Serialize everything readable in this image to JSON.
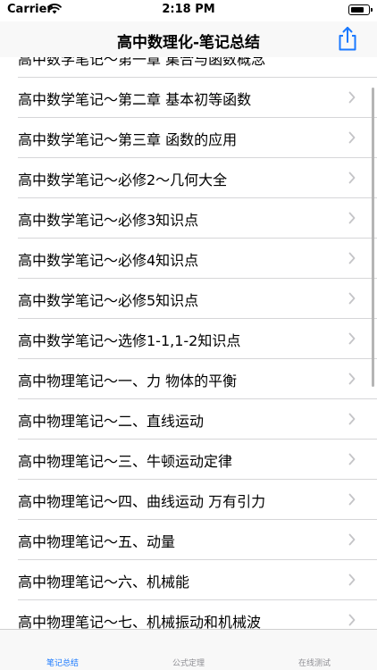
{
  "status_bar": {
    "carrier": "Carrier",
    "time": "2:18 PM"
  },
  "nav": {
    "title": "高中数理化-笔记总结",
    "share_icon": "share-icon"
  },
  "list": {
    "partial_item": "高中数学笔记～第一章 集合与函数概念",
    "items": [
      "高中数学笔记～第二章  基本初等函数",
      "高中数学笔记～第三章 函数的应用",
      "高中数学笔记～必修2～几何大全",
      "高中数学笔记～必修3知识点",
      "高中数学笔记～必修4知识点",
      "高中数学笔记～必修5知识点",
      "高中数学笔记～选修1-1,1-2知识点",
      "高中物理笔记～一、力 物体的平衡",
      "高中物理笔记～二、直线运动",
      "高中物理笔记～三、牛顿运动定律",
      "高中物理笔记～四、曲线运动 万有引力",
      "高中物理笔记～五、动量",
      "高中物理笔记～六、机械能",
      "高中物理笔记～七、机械振动和机械波"
    ]
  },
  "tabs": [
    {
      "label": "笔记总结",
      "active": true
    },
    {
      "label": "公式定理",
      "active": false
    },
    {
      "label": "在线测试",
      "active": false
    }
  ],
  "colors": {
    "accent": "#1a79ff",
    "inactive": "#8e8e93",
    "separator": "#d6d6d8",
    "chevron": "#c4c4c7"
  }
}
